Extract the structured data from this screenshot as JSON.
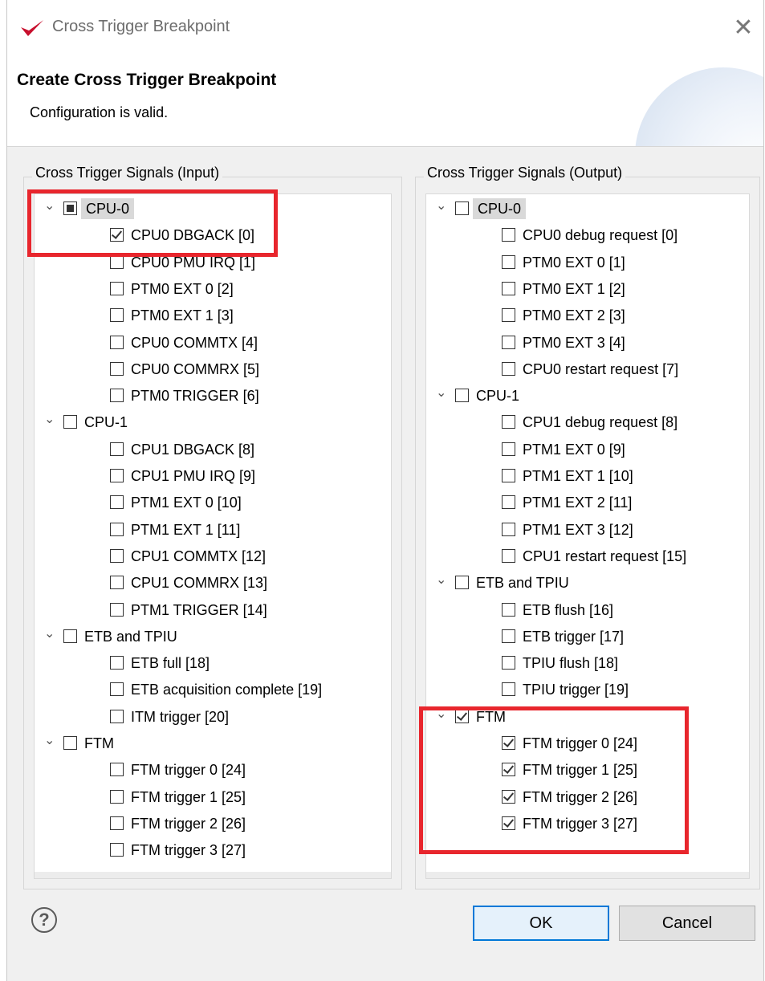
{
  "window": {
    "title": "Cross Trigger Breakpoint",
    "close_glyph": "✕",
    "icon": "vivado-logo-icon"
  },
  "banner": {
    "title": "Create Cross Trigger Breakpoint",
    "message": "Configuration is valid."
  },
  "input_group": {
    "label": "Cross Trigger Signals (Input)",
    "items": [
      {
        "label": "CPU-0",
        "level": 0,
        "state": "partial",
        "selected": true
      },
      {
        "label": "CPU0 DBGACK [0]",
        "level": 1,
        "state": "checked"
      },
      {
        "label": "CPU0 PMU IRQ [1]",
        "level": 1,
        "state": "unchecked"
      },
      {
        "label": "PTM0 EXT 0 [2]",
        "level": 1,
        "state": "unchecked"
      },
      {
        "label": "PTM0 EXT 1 [3]",
        "level": 1,
        "state": "unchecked"
      },
      {
        "label": "CPU0 COMMTX [4]",
        "level": 1,
        "state": "unchecked"
      },
      {
        "label": "CPU0 COMMRX [5]",
        "level": 1,
        "state": "unchecked"
      },
      {
        "label": "PTM0 TRIGGER [6]",
        "level": 1,
        "state": "unchecked"
      },
      {
        "label": "CPU-1",
        "level": 0,
        "state": "unchecked"
      },
      {
        "label": "CPU1 DBGACK [8]",
        "level": 1,
        "state": "unchecked"
      },
      {
        "label": "CPU1 PMU IRQ [9]",
        "level": 1,
        "state": "unchecked"
      },
      {
        "label": "PTM1 EXT 0 [10]",
        "level": 1,
        "state": "unchecked"
      },
      {
        "label": "PTM1 EXT 1 [11]",
        "level": 1,
        "state": "unchecked"
      },
      {
        "label": "CPU1 COMMTX [12]",
        "level": 1,
        "state": "unchecked"
      },
      {
        "label": "CPU1 COMMRX [13]",
        "level": 1,
        "state": "unchecked"
      },
      {
        "label": "PTM1 TRIGGER [14]",
        "level": 1,
        "state": "unchecked"
      },
      {
        "label": "ETB and TPIU",
        "level": 0,
        "state": "unchecked"
      },
      {
        "label": "ETB full [18]",
        "level": 1,
        "state": "unchecked"
      },
      {
        "label": "ETB acquisition complete [19]",
        "level": 1,
        "state": "unchecked"
      },
      {
        "label": "ITM trigger [20]",
        "level": 1,
        "state": "unchecked"
      },
      {
        "label": "FTM",
        "level": 0,
        "state": "unchecked"
      },
      {
        "label": "FTM trigger 0 [24]",
        "level": 1,
        "state": "unchecked"
      },
      {
        "label": "FTM trigger 1 [25]",
        "level": 1,
        "state": "unchecked"
      },
      {
        "label": "FTM trigger 2 [26]",
        "level": 1,
        "state": "unchecked"
      },
      {
        "label": "FTM trigger 3 [27]",
        "level": 1,
        "state": "unchecked"
      }
    ]
  },
  "output_group": {
    "label": "Cross Trigger Signals (Output)",
    "items": [
      {
        "label": "CPU-0",
        "level": 0,
        "state": "unchecked",
        "selected": true
      },
      {
        "label": "CPU0 debug request [0]",
        "level": 1,
        "state": "unchecked"
      },
      {
        "label": "PTM0 EXT 0 [1]",
        "level": 1,
        "state": "unchecked"
      },
      {
        "label": "PTM0 EXT 1 [2]",
        "level": 1,
        "state": "unchecked"
      },
      {
        "label": "PTM0 EXT 2 [3]",
        "level": 1,
        "state": "unchecked"
      },
      {
        "label": "PTM0 EXT 3 [4]",
        "level": 1,
        "state": "unchecked"
      },
      {
        "label": "CPU0 restart request [7]",
        "level": 1,
        "state": "unchecked"
      },
      {
        "label": "CPU-1",
        "level": 0,
        "state": "unchecked"
      },
      {
        "label": "CPU1 debug request [8]",
        "level": 1,
        "state": "unchecked"
      },
      {
        "label": "PTM1 EXT 0 [9]",
        "level": 1,
        "state": "unchecked"
      },
      {
        "label": "PTM1 EXT 1 [10]",
        "level": 1,
        "state": "unchecked"
      },
      {
        "label": "PTM1 EXT 2 [11]",
        "level": 1,
        "state": "unchecked"
      },
      {
        "label": "PTM1 EXT 3 [12]",
        "level": 1,
        "state": "unchecked"
      },
      {
        "label": "CPU1 restart request [15]",
        "level": 1,
        "state": "unchecked"
      },
      {
        "label": "ETB and TPIU",
        "level": 0,
        "state": "unchecked"
      },
      {
        "label": "ETB flush [16]",
        "level": 1,
        "state": "unchecked"
      },
      {
        "label": "ETB trigger [17]",
        "level": 1,
        "state": "unchecked"
      },
      {
        "label": "TPIU flush [18]",
        "level": 1,
        "state": "unchecked"
      },
      {
        "label": "TPIU trigger [19]",
        "level": 1,
        "state": "unchecked"
      },
      {
        "label": "FTM",
        "level": 0,
        "state": "checked"
      },
      {
        "label": "FTM trigger 0 [24]",
        "level": 1,
        "state": "checked"
      },
      {
        "label": "FTM trigger 1 [25]",
        "level": 1,
        "state": "checked"
      },
      {
        "label": "FTM trigger 2 [26]",
        "level": 1,
        "state": "checked"
      },
      {
        "label": "FTM trigger 3 [27]",
        "level": 1,
        "state": "checked"
      }
    ]
  },
  "footer": {
    "help_glyph": "?",
    "ok_label": "OK",
    "cancel_label": "Cancel"
  },
  "colors": {
    "highlight": "#e8262d",
    "ok_border": "#0078d7",
    "logo": "#c8102e"
  }
}
